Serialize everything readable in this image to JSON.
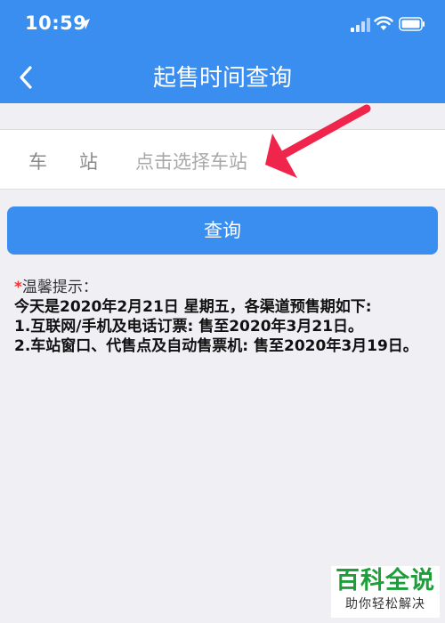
{
  "status_bar": {
    "time": "10:59"
  },
  "header": {
    "title": "起售时间查询"
  },
  "form": {
    "station_label": "车站",
    "station_placeholder": "点击选择车站"
  },
  "query_button": {
    "label": "查询"
  },
  "notice": {
    "title": "温馨提示：",
    "lines": [
      "今天是2020年2月21日 星期五，各渠道预售期如下:",
      "1.互联网/手机及电话订票: 售至2020年3月21日。",
      "2.车站窗口、代售点及自动售票机: 售至2020年3月19日。"
    ]
  },
  "watermark": {
    "main": "百科全说",
    "sub": "助你轻松解决"
  },
  "colors": {
    "accent": "#3a8eef",
    "background": "#efeff4",
    "required": "#e53935",
    "arrow": "#f0254c",
    "watermark": "#1e9e3a"
  },
  "icons": {
    "back": "chevron-left-icon",
    "location": "location-arrow-icon",
    "signal": "cellular-signal-icon",
    "wifi": "wifi-icon",
    "battery": "battery-icon"
  }
}
